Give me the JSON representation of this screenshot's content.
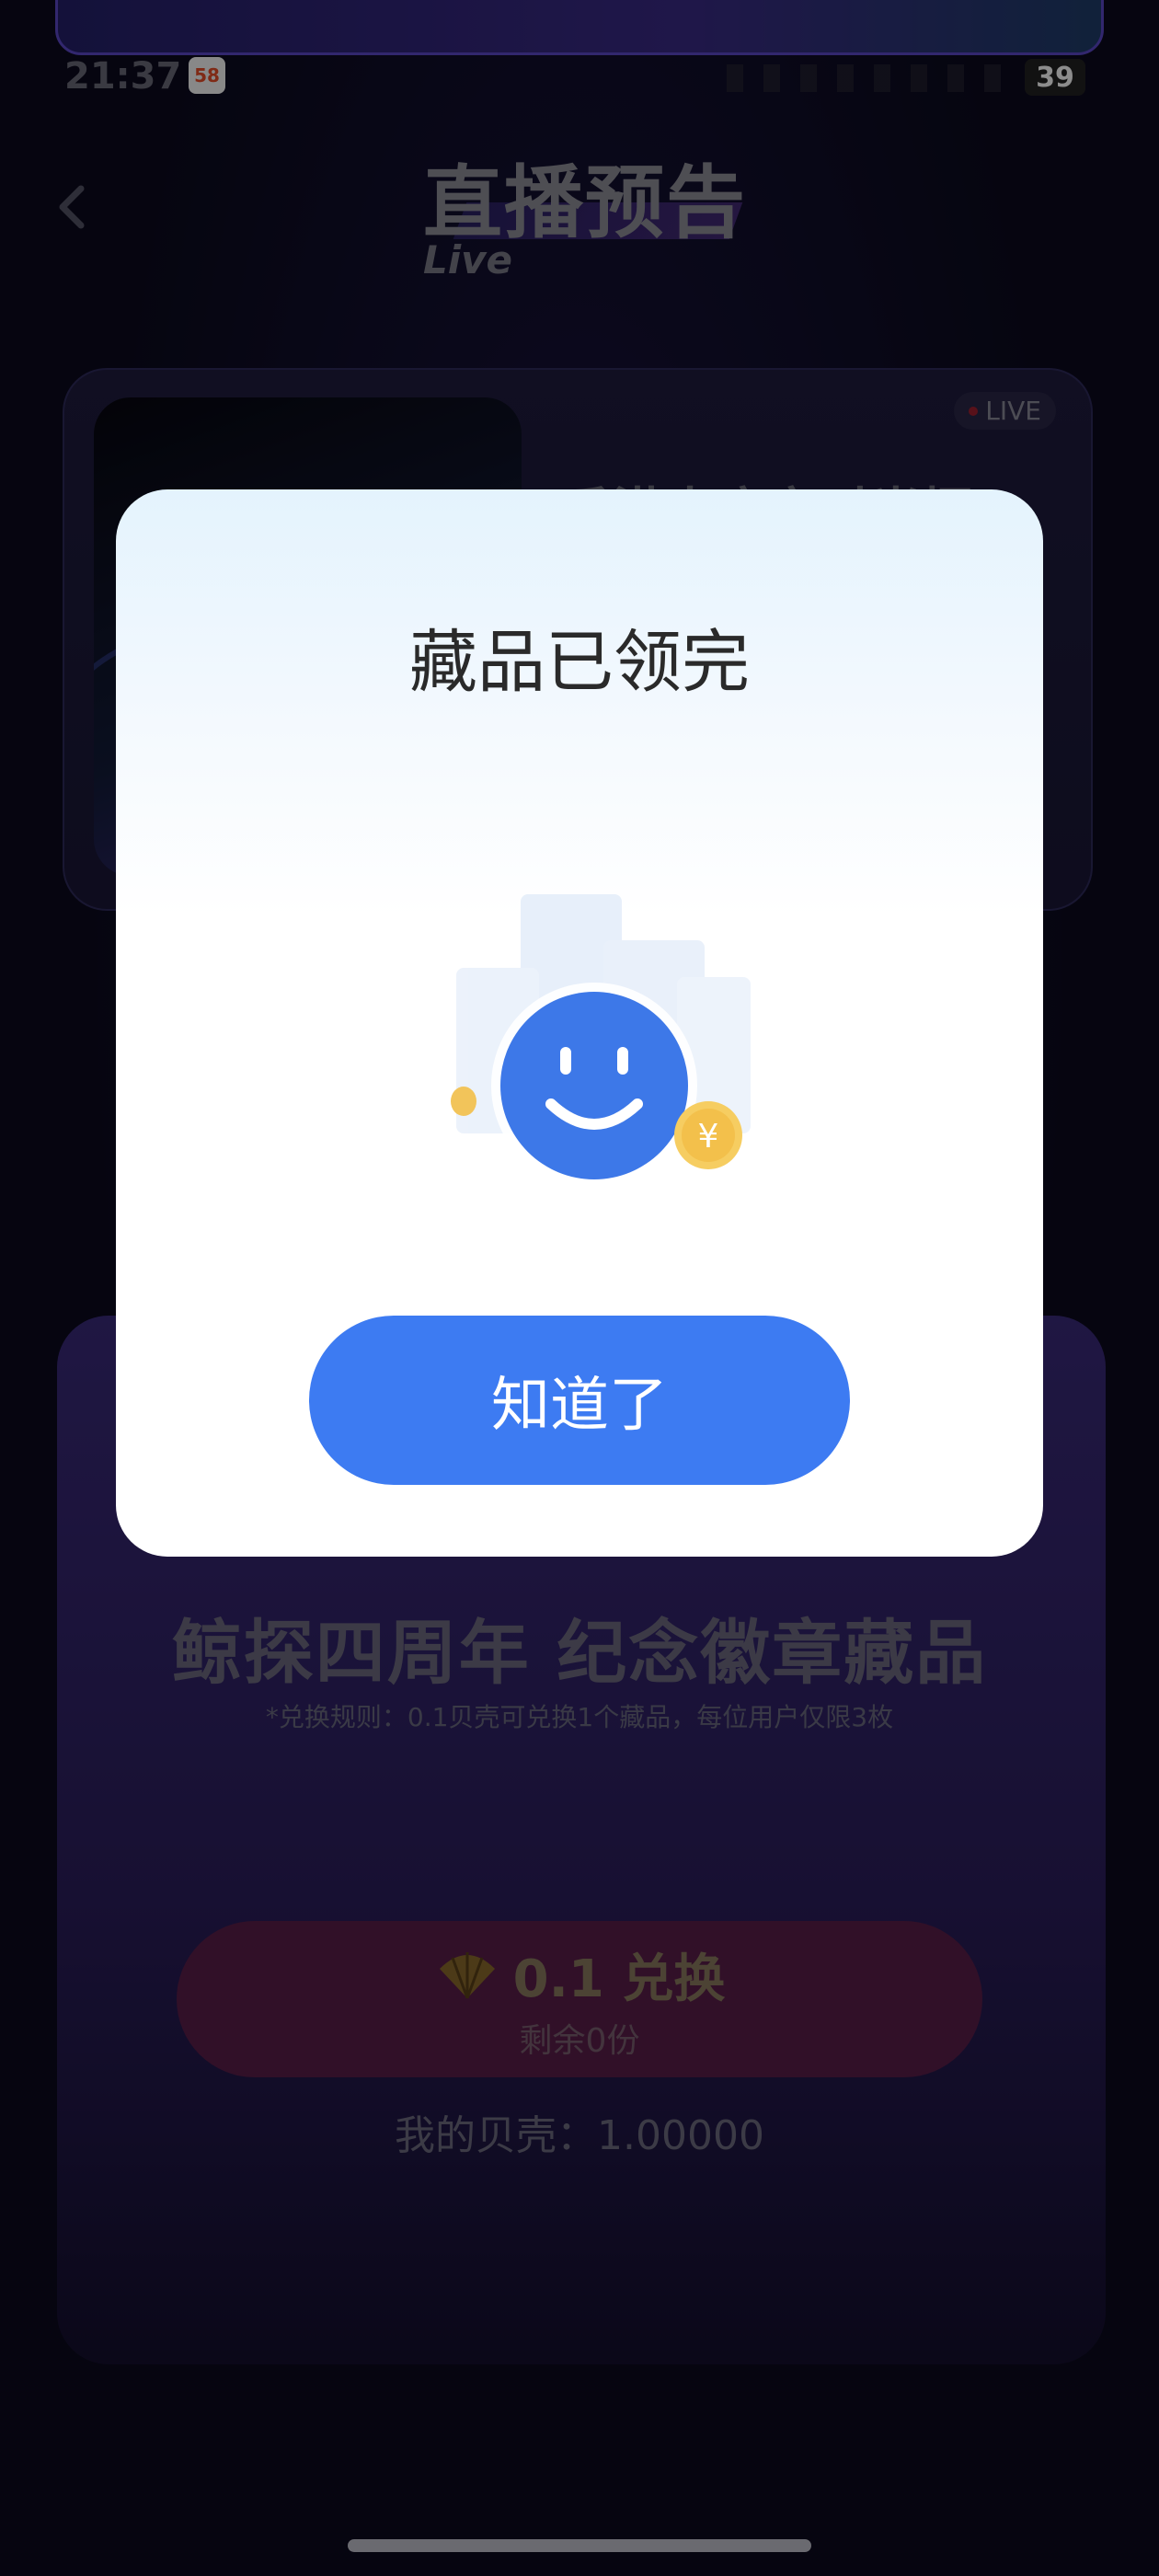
{
  "status_bar": {
    "time": "21:37",
    "app_icon_text": "58",
    "battery": "39"
  },
  "header": {
    "title": "直播预告",
    "subtitle": "Live"
  },
  "live_card": {
    "badge": "LIVE",
    "title": "香港大庙宫时光探"
  },
  "exchange": {
    "title": "鲸探四周年 纪念徽章藏品",
    "rule": "*兑换规则：0.1贝壳可兑换1个藏品，每位用户仅限3枚",
    "price_label": "0.1 兑换",
    "remaining": "剩余0份",
    "my_shells": "我的贝壳：1.00000"
  },
  "modal": {
    "title": "藏品已领完",
    "button_label": "知道了"
  },
  "colors": {
    "accent": "#3d7bf2",
    "modal_bg": "#ffffff",
    "page_bg": "#0b0a1e"
  },
  "icons": {
    "back": "chevron-left-icon",
    "illustration": "smiley-face-icon",
    "coin": "yen-coin-icon",
    "shell": "shell-icon"
  }
}
